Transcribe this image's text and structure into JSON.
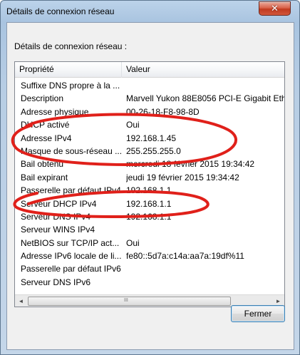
{
  "window": {
    "title": "Détails de connexion réseau"
  },
  "dialog": {
    "section_label": "Détails de connexion réseau :",
    "columns": [
      "Propriété",
      "Valeur"
    ],
    "rows": [
      {
        "property": "Suffixe DNS propre à la ...",
        "value": ""
      },
      {
        "property": "Description",
        "value": "Marvell Yukon 88E8056 PCI-E Gigabit Eth"
      },
      {
        "property": "Adresse physique",
        "value": "00-26-18-F8-98-8D"
      },
      {
        "property": "DHCP activé",
        "value": "Oui"
      },
      {
        "property": "Adresse IPv4",
        "value": "192.168.1.45"
      },
      {
        "property": "Masque de sous-réseau ...",
        "value": "255.255.255.0"
      },
      {
        "property": "Bail obtenu",
        "value": "mercredi 18 février 2015 19:34:42"
      },
      {
        "property": "Bail expirant",
        "value": "jeudi 19 février 2015 19:34:42"
      },
      {
        "property": "Passerelle par défaut IPv4",
        "value": "192.168.1.1"
      },
      {
        "property": "Serveur DHCP IPv4",
        "value": "192.168.1.1"
      },
      {
        "property": "Serveur DNS IPv4",
        "value": "192.168.1.1"
      },
      {
        "property": "Serveur WINS IPv4",
        "value": ""
      },
      {
        "property": "NetBIOS sur TCP/IP act...",
        "value": "Oui"
      },
      {
        "property": "Adresse IPv6 locale de li...",
        "value": "fe80::5d7a:c14a:aa7a:19df%11"
      },
      {
        "property": "Passerelle par défaut IPv6",
        "value": ""
      },
      {
        "property": "Serveur DNS IPv6",
        "value": ""
      }
    ],
    "scrollbar": {
      "left_arrow": "◄",
      "right_arrow": "►",
      "grip": "III"
    },
    "close_button_label": "Fermer"
  },
  "icons": {
    "close": "close-icon"
  },
  "colors": {
    "annotation_red": "#e0201a",
    "title_bar": "#b9cfe7",
    "close_button": "#c7422a"
  }
}
